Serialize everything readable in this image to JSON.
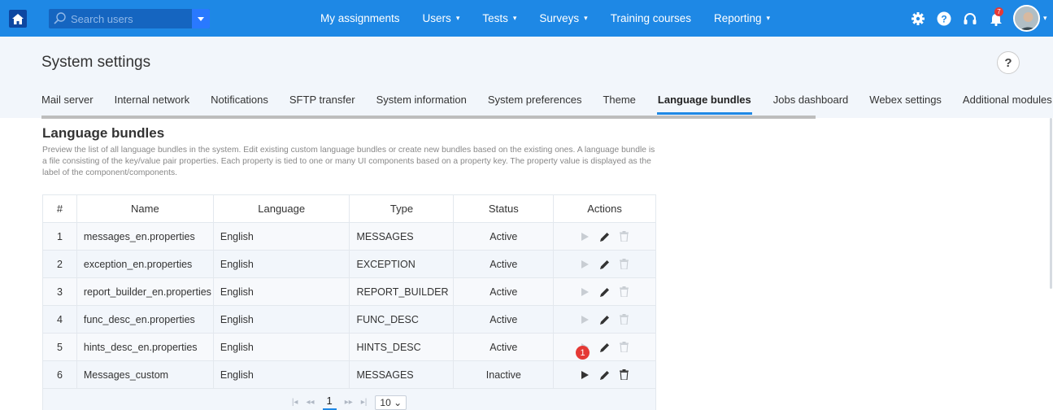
{
  "topbar": {
    "search_placeholder": "Search users",
    "nav": [
      {
        "label": "My assignments",
        "caret": ""
      },
      {
        "label": "Users",
        "caret": "▾"
      },
      {
        "label": "Tests",
        "caret": "▾"
      },
      {
        "label": "Surveys",
        "caret": "▾"
      },
      {
        "label": "Training courses",
        "caret": ""
      },
      {
        "label": "Reporting",
        "caret": "▾"
      }
    ],
    "notification_count": "7",
    "accent": "#1e88e5"
  },
  "header": {
    "title": "System settings",
    "help": "?",
    "tabs": [
      "Mail server",
      "Internal network",
      "Notifications",
      "SFTP transfer",
      "System information",
      "System preferences",
      "Theme",
      "Language bundles",
      "Jobs dashboard",
      "Webex settings",
      "Additional modules"
    ],
    "active_tab": "Language bundles"
  },
  "section": {
    "title": "Language bundles",
    "description": "Preview the list of all language bundles in the system. Edit existing custom language bundles or create new bundles based on the existing ones. A language bundle is a file consisting of the key/value pair properties. Each property is tied to one or many UI components based on a property key. The property value is displayed as the label of the component/components."
  },
  "table": {
    "headers": [
      "#",
      "Name",
      "Language",
      "Type",
      "Status",
      "Actions"
    ],
    "rows": [
      {
        "num": "1",
        "name": "messages_en.properties",
        "language": "English",
        "type": "MESSAGES",
        "status": "Active"
      },
      {
        "num": "2",
        "name": "exception_en.properties",
        "language": "English",
        "type": "EXCEPTION",
        "status": "Active"
      },
      {
        "num": "3",
        "name": "report_builder_en.properties",
        "language": "English",
        "type": "REPORT_BUILDER",
        "status": "Active"
      },
      {
        "num": "4",
        "name": "func_desc_en.properties",
        "language": "English",
        "type": "FUNC_DESC",
        "status": "Active"
      },
      {
        "num": "5",
        "name": "hints_desc_en.properties",
        "language": "English",
        "type": "HINTS_DESC",
        "status": "Active"
      },
      {
        "num": "6",
        "name": "Messages_custom",
        "language": "English",
        "type": "MESSAGES",
        "status": "Inactive"
      }
    ],
    "pager": {
      "first": "|◂",
      "prev": "◂◂",
      "page": "1",
      "next": "▸▸",
      "last": "▸|",
      "page_size": "10"
    }
  },
  "step_badge": "1",
  "colors": {
    "active": "#3a9a3a",
    "inactive": "#e53935",
    "badge": "#e53935"
  }
}
